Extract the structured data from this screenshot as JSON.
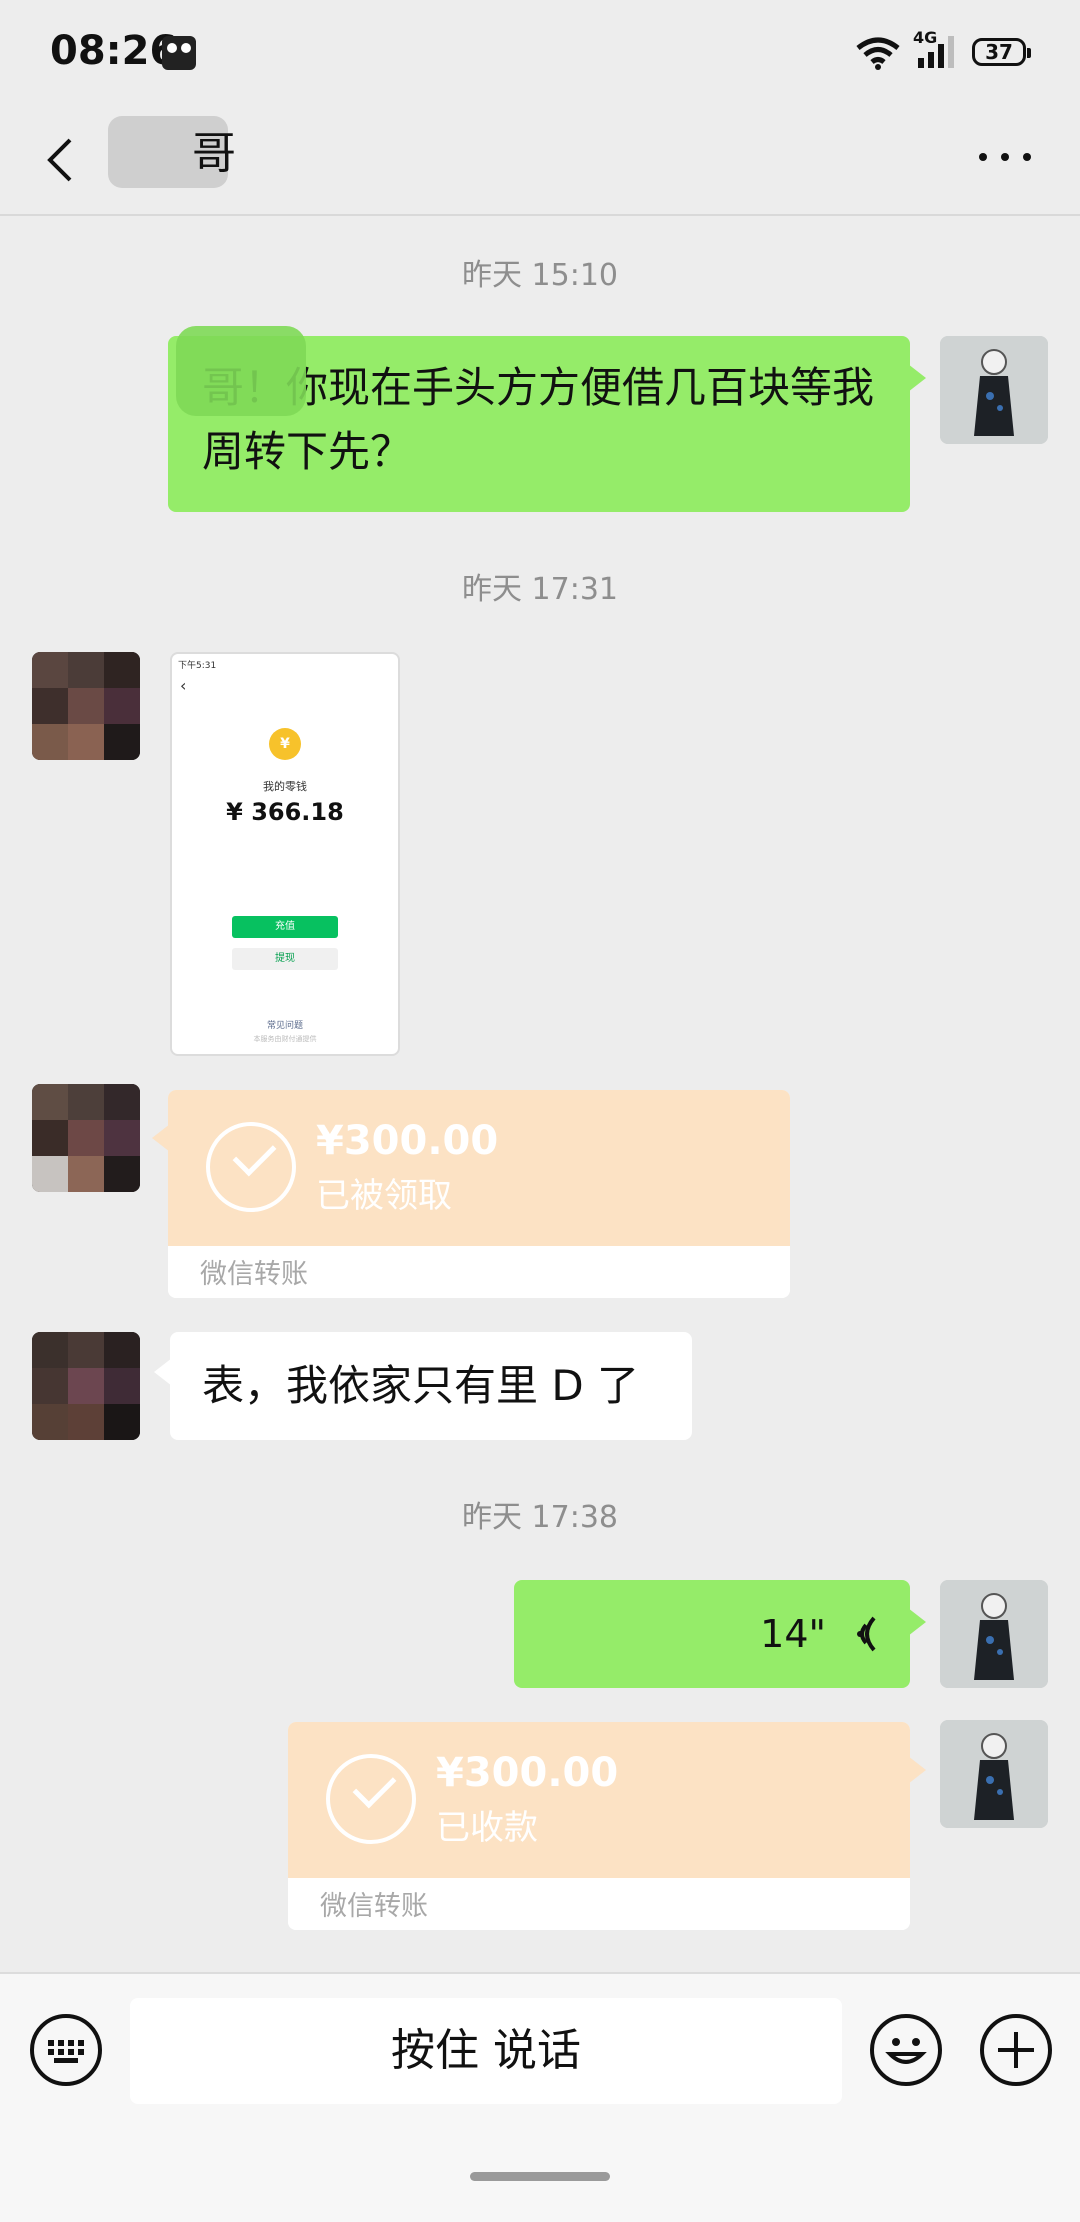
{
  "status_bar": {
    "time": "08:26",
    "network": "4G",
    "battery": "37"
  },
  "header": {
    "title": "哥"
  },
  "messages": {
    "ts1": "昨天 15:10",
    "msg1": "哥！你现在手头方方便借几百块等我周转下先？",
    "ts2": "昨天 17:31",
    "screenshot": {
      "status": "下午5:31",
      "label": "我的零钱",
      "balance": "¥ 366.18",
      "recharge": "充值",
      "withdraw": "提现",
      "faq": "常见问题",
      "footer": "本服务由财付通提供"
    },
    "transfer1": {
      "amount": "¥300.00",
      "status": "已被领取",
      "label": "微信转账"
    },
    "msg2": "表，我依家只有里 D 了",
    "ts3": "昨天 17:38",
    "voice": "14\"",
    "transfer2": {
      "amount": "¥300.00",
      "status": "已收款",
      "label": "微信转账"
    }
  },
  "input": {
    "hold_to_talk": "按住 说话"
  },
  "colors": {
    "green_bubble": "#95ec69",
    "transfer_orange": "#fce2c4",
    "background": "#ededed"
  }
}
